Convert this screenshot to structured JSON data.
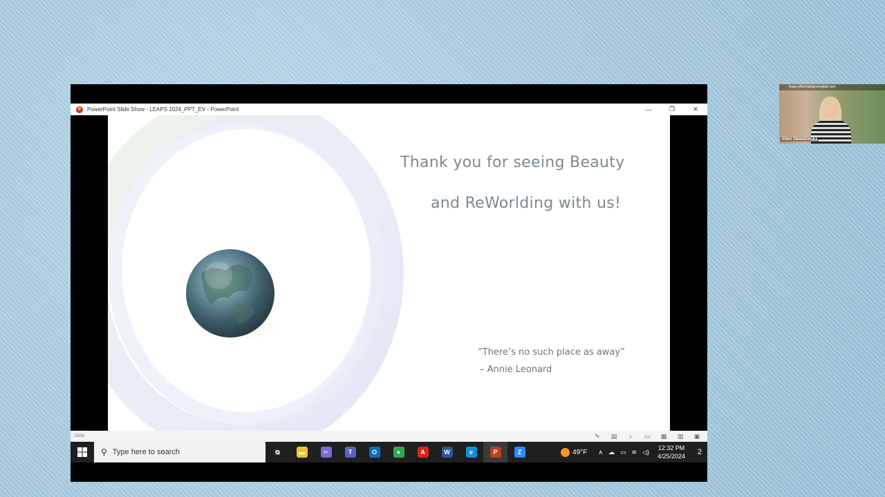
{
  "window": {
    "title": "PowerPoint Slide Show  -  LEAPS 2024_PPT_EV - PowerPoint",
    "minimize": "—",
    "restore": "❐",
    "close": "✕"
  },
  "slide": {
    "title_line1": "Thank you for seeing Beauty",
    "title_line2": "and ReWorlding with us!",
    "quote_line1": "“There’s no such place as away”",
    "quote_line2": "– Annie Leonard"
  },
  "statusbar": {
    "label": "Slide"
  },
  "taskbar": {
    "search_placeholder": "Type here to search",
    "apps": [
      {
        "name": "task-view",
        "glyph": "⧉",
        "color": "#1f1f1f"
      },
      {
        "name": "file-explorer",
        "glyph": "▬",
        "color": "#f3c02b"
      },
      {
        "name": "snip",
        "glyph": "✂",
        "color": "#7a6bd8"
      },
      {
        "name": "teams",
        "glyph": "T",
        "color": "#5b5fc7"
      },
      {
        "name": "outlook",
        "glyph": "O",
        "color": "#0f6cbd"
      },
      {
        "name": "chrome",
        "glyph": "●",
        "color": "#34a853"
      },
      {
        "name": "acrobat",
        "glyph": "A",
        "color": "#d8261d"
      },
      {
        "name": "word",
        "glyph": "W",
        "color": "#2b579a"
      },
      {
        "name": "edge",
        "glyph": "e",
        "color": "#0f8fd6"
      },
      {
        "name": "powerpoint",
        "glyph": "P",
        "color": "#c43e1c"
      },
      {
        "name": "zoom",
        "glyph": "Z",
        "color": "#2d8cff"
      }
    ],
    "weather": "49°F",
    "time": "12:32 PM",
    "date": "4/25/2024",
    "notification_count": "2"
  },
  "video": {
    "url_text": "leaps.aftermathgreenglab.com",
    "participant_name": "Ellen Obiedzinska"
  }
}
